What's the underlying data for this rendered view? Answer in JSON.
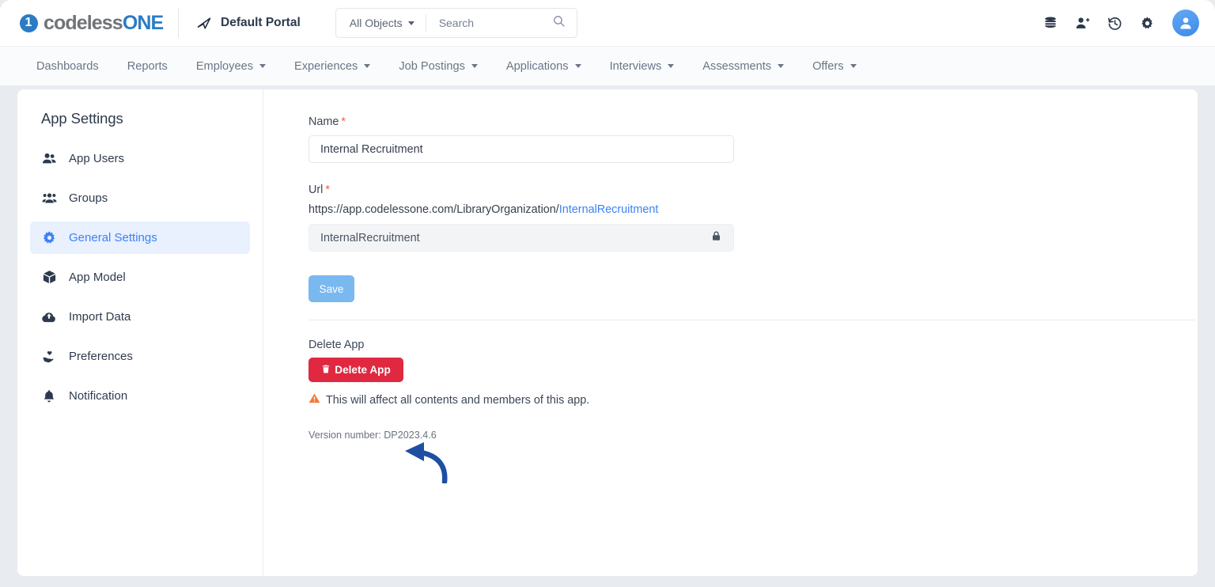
{
  "topbar": {
    "logo_mark": "1",
    "logo_text_light": "codeless",
    "logo_text_bold": "ONE",
    "portal_label": "Default Portal",
    "portal_icon": "paper-plane-icon",
    "object_filter_label": "All Objects",
    "search_placeholder": "Search",
    "search_icon": "search-icon",
    "actions": [
      {
        "name": "database-icon",
        "label": "Database"
      },
      {
        "name": "add-user-icon",
        "label": "Add User"
      },
      {
        "name": "history-icon",
        "label": "History"
      },
      {
        "name": "gear-icon",
        "label": "Settings"
      }
    ],
    "avatar_icon": "user-avatar-icon"
  },
  "nav": {
    "items": [
      {
        "label": "Dashboards",
        "has_caret": false
      },
      {
        "label": "Reports",
        "has_caret": false
      },
      {
        "label": "Employees",
        "has_caret": true
      },
      {
        "label": "Experiences",
        "has_caret": true
      },
      {
        "label": "Job Postings",
        "has_caret": true
      },
      {
        "label": "Applications",
        "has_caret": true
      },
      {
        "label": "Interviews",
        "has_caret": true
      },
      {
        "label": "Assessments",
        "has_caret": true
      },
      {
        "label": "Offers",
        "has_caret": true
      }
    ]
  },
  "sidebar": {
    "title": "App Settings",
    "items": [
      {
        "label": "App Users",
        "icon": "users-icon",
        "active": false
      },
      {
        "label": "Groups",
        "icon": "group-icon",
        "active": false
      },
      {
        "label": "General Settings",
        "icon": "gear-icon",
        "active": true
      },
      {
        "label": "App Model",
        "icon": "cube-icon",
        "active": false
      },
      {
        "label": "Import Data",
        "icon": "cloud-upload-icon",
        "active": false
      },
      {
        "label": "Preferences",
        "icon": "hand-heart-icon",
        "active": false
      },
      {
        "label": "Notification",
        "icon": "bell-icon",
        "active": false
      }
    ]
  },
  "form": {
    "name_label": "Name",
    "name_required": "*",
    "name_value": "Internal Recruitment",
    "url_label": "Url",
    "url_required": "*",
    "url_prefix": "https://app.codelessone.com/LibraryOrganization/",
    "url_slug": "InternalRecruitment",
    "slug_value": "InternalRecruitment",
    "slug_lock_icon": "lock-icon",
    "save_label": "Save"
  },
  "danger": {
    "section_label": "Delete App",
    "delete_button_label": "Delete App",
    "delete_icon": "trash-icon",
    "warning_icon": "warning-triangle-icon",
    "warning_text": "This will affect all contents and members of this app.",
    "version_text": "Version number: DP2023.4.6"
  },
  "annotation": {
    "arrow_name": "pointer-arrow-annotation",
    "arrow_color": "#1e4fa3"
  },
  "colors": {
    "brand_blue": "#2b7cc4",
    "accent_blue": "#3b82f6",
    "save_blue": "#7ab8f0",
    "danger_red": "#e02841",
    "warning_orange": "#f27a35",
    "required_red": "#f05a5a",
    "page_bg": "#e8ebef"
  }
}
